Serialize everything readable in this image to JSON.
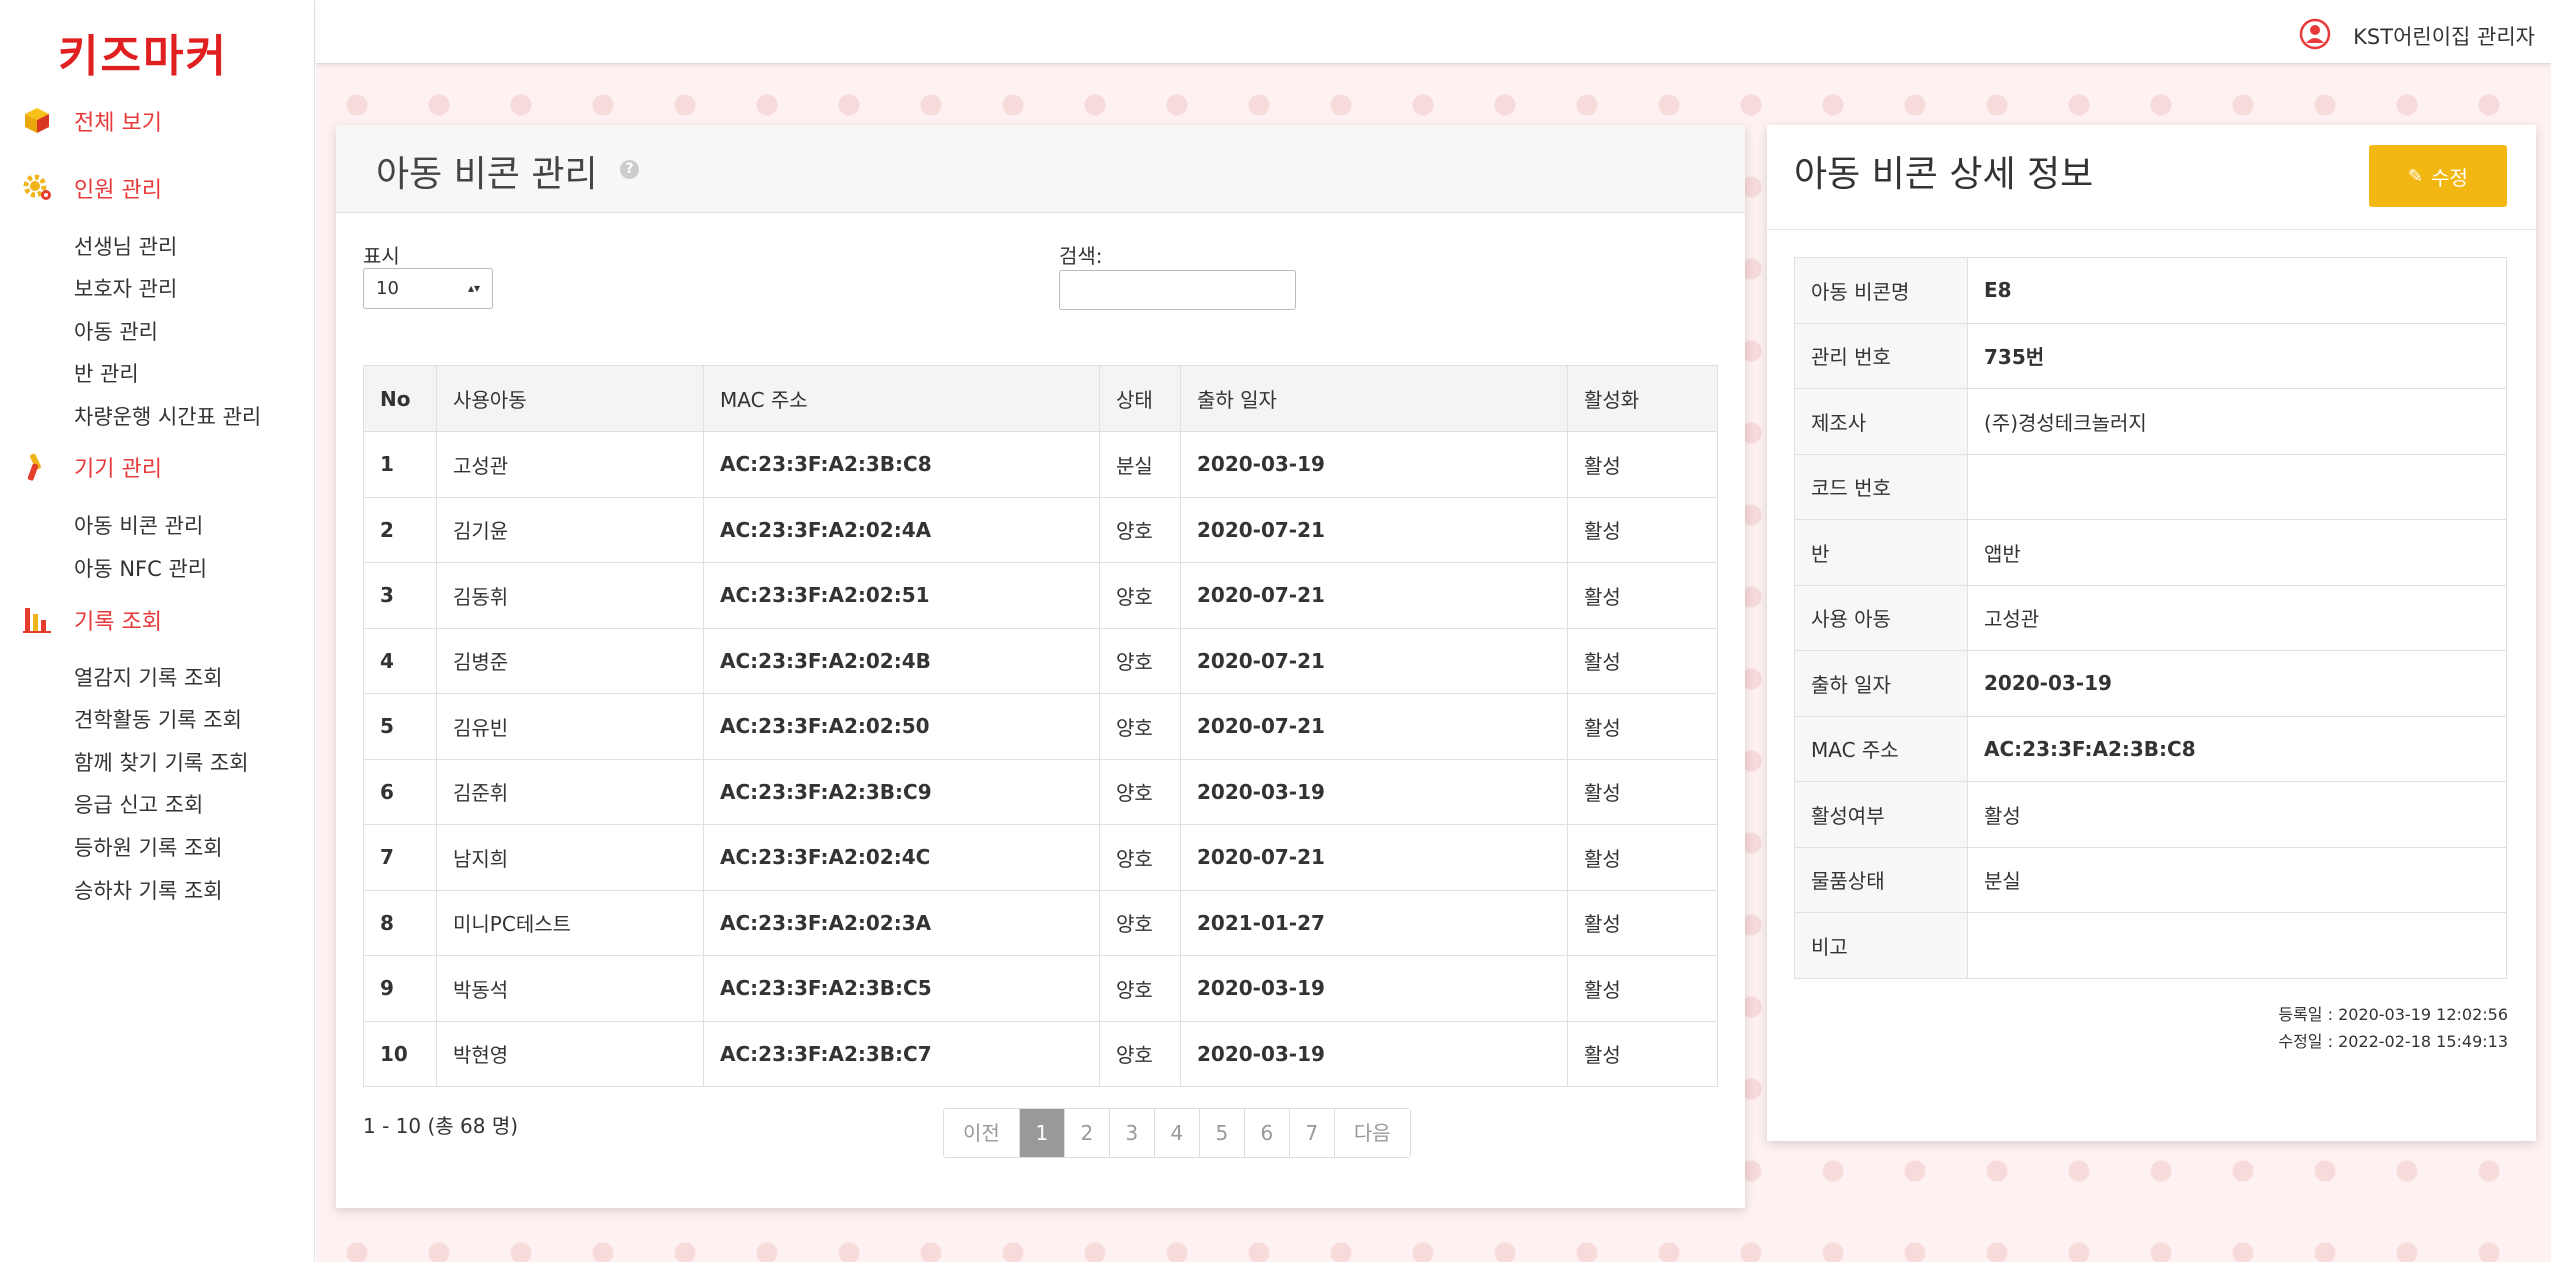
{
  "brand": {
    "logo_text": "키즈마커",
    "logo_color": "#e02020",
    "accent": "#e83a3a"
  },
  "topbar": {
    "user_label": "KST어린이집 관리자",
    "user_icon": "user-circle-icon"
  },
  "sidebar": {
    "sections": [
      {
        "label": "전체 보기",
        "icon": "cube-icon",
        "items": []
      },
      {
        "label": "인원 관리",
        "icon": "gear-icon",
        "items": [
          "선생님 관리",
          "보호자 관리",
          "아동 관리",
          "반 관리",
          "차량운행 시간표 관리"
        ]
      },
      {
        "label": "기기 관리",
        "icon": "tools-icon",
        "items": [
          "아동 비콘 관리",
          "아동 NFC 관리"
        ]
      },
      {
        "label": "기록 조회",
        "icon": "bar-chart-icon",
        "items": [
          "열감지 기록 조회",
          "견학활동 기록 조회",
          "함께 찾기 기록 조회",
          "응급 신고 조회",
          "등하원 기록 조회",
          "승하차 기록 조회"
        ]
      }
    ]
  },
  "list_panel": {
    "title": "아동 비콘 관리",
    "help_icon": "question-circle-icon",
    "show_label": "표시",
    "show_value": "10",
    "search_label": "검색:",
    "search_value": "",
    "columns": [
      "No",
      "사용아동",
      "MAC 주소",
      "상태",
      "출하 일자",
      "활성화"
    ],
    "rows": [
      [
        "1",
        "고성관",
        "AC:23:3F:A2:3B:C8",
        "분실",
        "2020-03-19",
        "활성"
      ],
      [
        "2",
        "김기윤",
        "AC:23:3F:A2:02:4A",
        "양호",
        "2020-07-21",
        "활성"
      ],
      [
        "3",
        "김동휘",
        "AC:23:3F:A2:02:51",
        "양호",
        "2020-07-21",
        "활성"
      ],
      [
        "4",
        "김병준",
        "AC:23:3F:A2:02:4B",
        "양호",
        "2020-07-21",
        "활성"
      ],
      [
        "5",
        "김유빈",
        "AC:23:3F:A2:02:50",
        "양호",
        "2020-07-21",
        "활성"
      ],
      [
        "6",
        "김준휘",
        "AC:23:3F:A2:3B:C9",
        "양호",
        "2020-03-19",
        "활성"
      ],
      [
        "7",
        "남지희",
        "AC:23:3F:A2:02:4C",
        "양호",
        "2020-07-21",
        "활성"
      ],
      [
        "8",
        "미니PC테스트",
        "AC:23:3F:A2:02:3A",
        "양호",
        "2021-01-27",
        "활성"
      ],
      [
        "9",
        "박동석",
        "AC:23:3F:A2:3B:C5",
        "양호",
        "2020-03-19",
        "활성"
      ],
      [
        "10",
        "박현영",
        "AC:23:3F:A2:3B:C7",
        "양호",
        "2020-03-19",
        "활성"
      ]
    ],
    "info": "1 - 10 (총 68 명)",
    "pagination": {
      "prev": "이전",
      "next": "다음",
      "pages": [
        "1",
        "2",
        "3",
        "4",
        "5",
        "6",
        "7"
      ],
      "current": "1"
    }
  },
  "detail_panel": {
    "title": "아동 비콘 상세 정보",
    "edit_label": "수정",
    "edit_color": "#f2b811",
    "fields": [
      {
        "label": "아동 비콘명",
        "value": "E8"
      },
      {
        "label": "관리 번호",
        "value": "735번"
      },
      {
        "label": "제조사",
        "value": "(주)경성테크놀러지"
      },
      {
        "label": "코드 번호",
        "value": ""
      },
      {
        "label": "반",
        "value": "앱반"
      },
      {
        "label": "사용 아동",
        "value": "고성관"
      },
      {
        "label": "출하 일자",
        "value": "2020-03-19"
      },
      {
        "label": "MAC 주소",
        "value": "AC:23:3F:A2:3B:C8"
      },
      {
        "label": "활성여부",
        "value": "활성"
      },
      {
        "label": "물품상태",
        "value": "분실"
      },
      {
        "label": "비고",
        "value": ""
      }
    ],
    "registered": "등록일 : 2020-03-19 12:02:56",
    "modified": "수정일 : 2022-02-18 15:49:13"
  }
}
